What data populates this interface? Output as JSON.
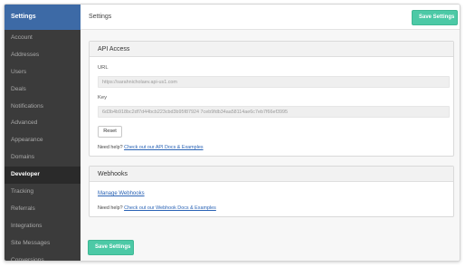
{
  "sidebar": {
    "header": "Settings",
    "items": [
      {
        "label": "Account",
        "active": false
      },
      {
        "label": "Addresses",
        "active": false
      },
      {
        "label": "Users",
        "active": false
      },
      {
        "label": "Deals",
        "active": false
      },
      {
        "label": "Notifications",
        "active": false
      },
      {
        "label": "Advanced",
        "active": false
      },
      {
        "label": "Appearance",
        "active": false
      },
      {
        "label": "Domains",
        "active": false
      },
      {
        "label": "Developer",
        "active": true
      },
      {
        "label": "Tracking",
        "active": false
      },
      {
        "label": "Referrals",
        "active": false
      },
      {
        "label": "Integrations",
        "active": false
      },
      {
        "label": "Site Messages",
        "active": false
      },
      {
        "label": "Conversions",
        "active": false
      }
    ]
  },
  "header": {
    "title": "Settings",
    "save_label": "Save Settings"
  },
  "api_access": {
    "title": "API Access",
    "url_label": "URL",
    "url_value": "https://sarahnicholaev.api-us1.com",
    "key_label": "Key",
    "key_value": "6d3b4b918bc2df7d44bcb223cbd3b95f87924 7ceb9fdb34aa58114ae6c7eb7f66ef3995",
    "reset_label": "Reset",
    "help_prefix": "Need help?",
    "help_link": "Check out our API Docs & Examples"
  },
  "webhooks": {
    "title": "Webhooks",
    "manage_link": "Manage Webhooks",
    "help_prefix": "Need help?",
    "help_link": "Check out our Webhook Docs & Examples"
  },
  "footer": {
    "save_label": "Save Settings"
  },
  "colors": {
    "sidebar_bg": "#3b3b3b",
    "sidebar_header": "#3d6aa6",
    "accent_green": "#4cc9a6",
    "link_blue": "#2a63b5"
  }
}
